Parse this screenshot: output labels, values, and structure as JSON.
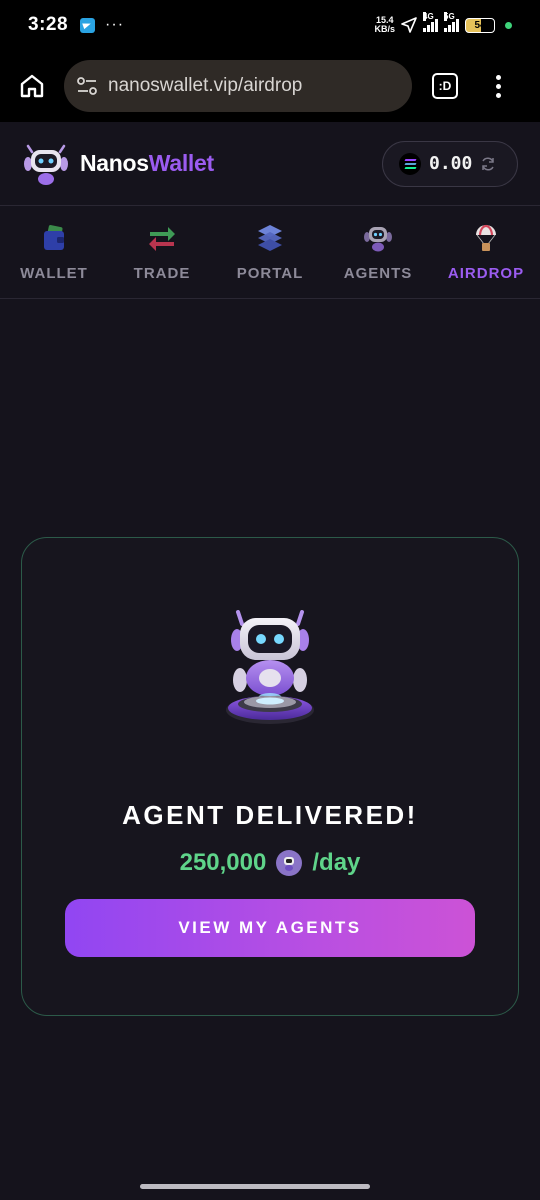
{
  "status_bar": {
    "time": "3:28",
    "dots": "···",
    "netspeed_value": "15.4",
    "netspeed_unit": "KB/s",
    "sig1_label": "4G",
    "sig2_label": "5G",
    "battery": "54"
  },
  "browser": {
    "url": "nanoswallet.vip/airdrop",
    "tab_label": ":D"
  },
  "header": {
    "brand_part1": "Nanos",
    "brand_part2": "Wallet",
    "balance": "0.00"
  },
  "tabs": [
    {
      "label": "WALLET",
      "icon": "wallet-icon"
    },
    {
      "label": "TRADE",
      "icon": "trade-arrows-icon"
    },
    {
      "label": "PORTAL",
      "icon": "portal-layers-icon"
    },
    {
      "label": "AGENTS",
      "icon": "agent-robot-icon"
    },
    {
      "label": "AIRDROP",
      "icon": "parachute-icon"
    }
  ],
  "active_tab": "AIRDROP",
  "card": {
    "title": "AGENT DELIVERED!",
    "reward_amount": "250,000",
    "reward_unit": "/day",
    "button_label": "VIEW MY AGENTS"
  },
  "colors": {
    "accent": "#9b5cf0",
    "reward_green": "#5fd48a",
    "card_border": "#2c5a49",
    "background": "#15131c"
  }
}
